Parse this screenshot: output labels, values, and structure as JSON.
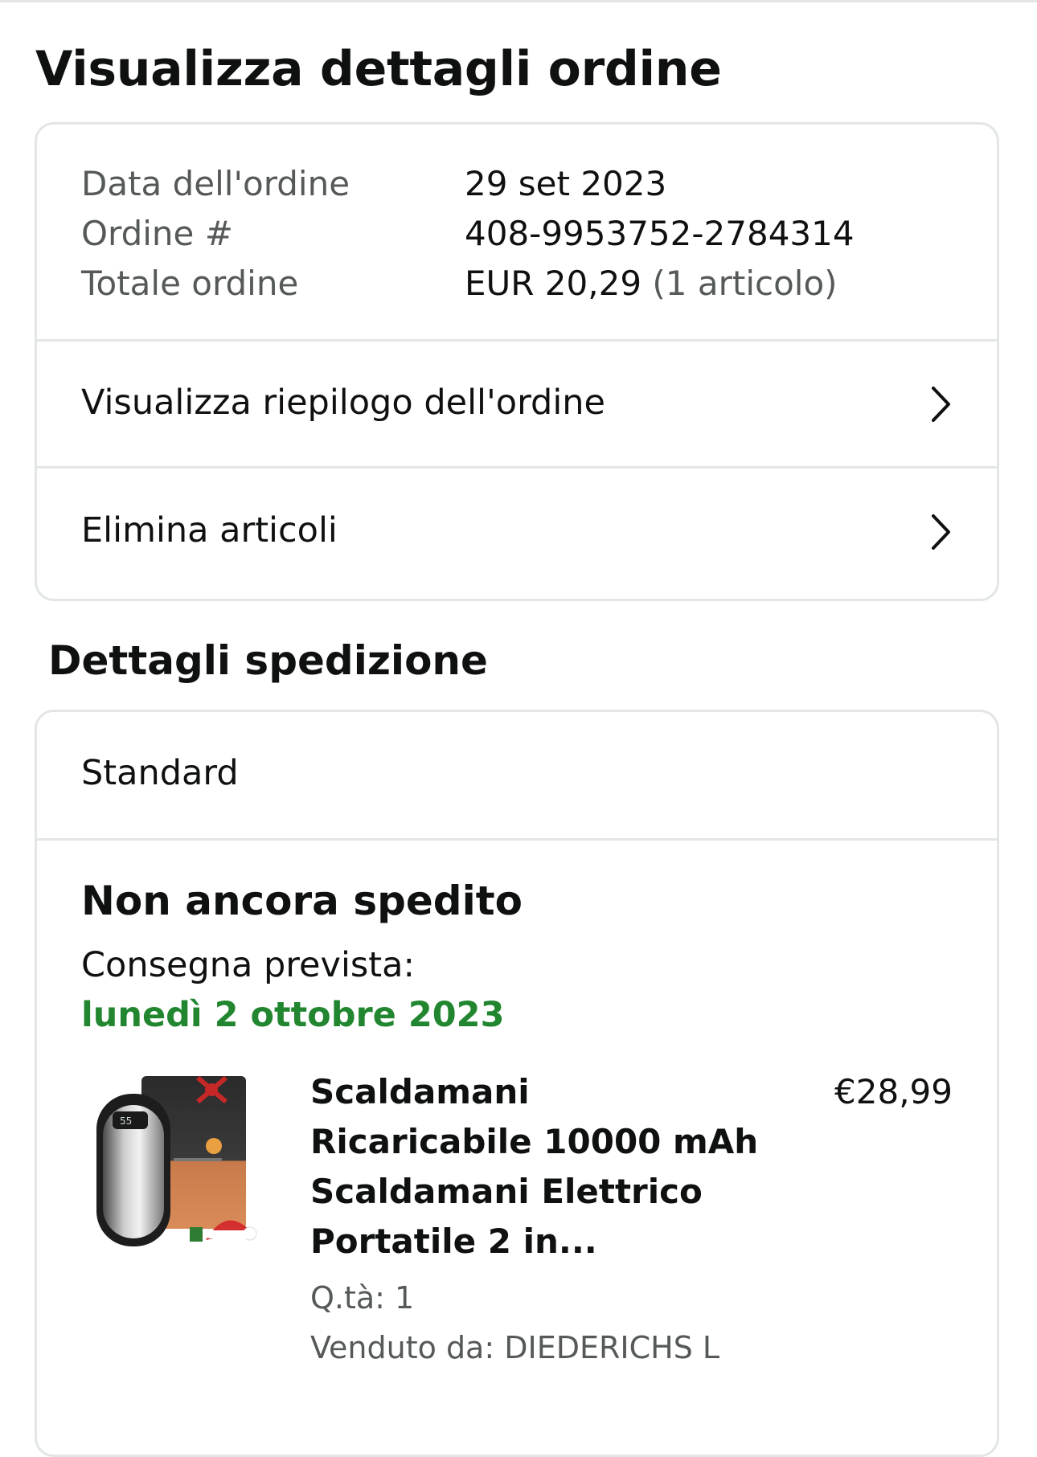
{
  "page": {
    "title": "Visualizza dettagli ordine"
  },
  "order_info": {
    "date_label": "Data dell'ordine",
    "date_value": "29 set 2023",
    "number_label": "Ordine #",
    "number_value": "408-9953752-2784314",
    "total_label": "Totale ordine",
    "total_value": "EUR 20,29",
    "total_items": "(1 articolo)"
  },
  "actions": {
    "summary_label": "Visualizza riepilogo dell'ordine",
    "delete_label": "Elimina articoli"
  },
  "shipping": {
    "section_title": "Dettagli spedizione",
    "method": "Standard",
    "status": "Non ancora spedito",
    "delivery_label": "Consegna prevista:",
    "delivery_date": "lunedì 2 ottobre 2023",
    "status_color": "#21862f"
  },
  "product": {
    "title": "Scaldamani Ricaricabile 10000 mAh Scaldamani Elettrico Portatile 2 in...",
    "price": "€28,99",
    "quantity": "Q.tà: 1",
    "seller": "Venduto da: DIEDERICHS L",
    "image": "hand-warmer-product-image"
  },
  "icons": {
    "row_action": "chevron-right-icon"
  }
}
